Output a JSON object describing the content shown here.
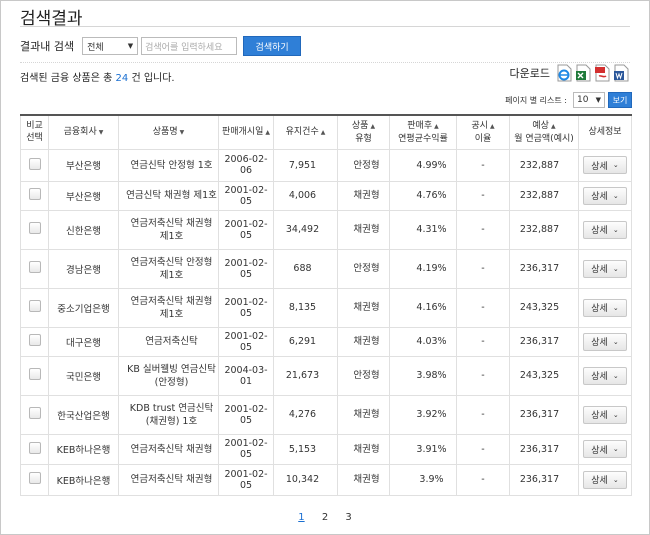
{
  "page_title": "검색결과",
  "search": {
    "label": "결과내 검색",
    "scope_selected": "전체",
    "keyword_placeholder": "검색어를 입력하세요",
    "button": "검색하기"
  },
  "summary": {
    "prefix": "검색된 금융 상품은 총",
    "count": "24",
    "suffix": "건 입니다."
  },
  "download": {
    "label": "다운로드",
    "icons": [
      "internet-explorer-icon",
      "excel-icon",
      "pdf-icon",
      "word-icon"
    ]
  },
  "per_page": {
    "label": "페이지 별 리스트 :",
    "selected": "10",
    "button": "보기"
  },
  "table": {
    "headers": {
      "compare_1": "비교",
      "compare_2": "선택",
      "company": "금융회사",
      "product": "상품명",
      "launch_date": "판매개시일",
      "count": "유지건수",
      "type_1": "상품",
      "type_2": "유형",
      "yield_1": "판매후",
      "yield_2": "연평균수익률",
      "disclosure_1": "공시",
      "disclosure_2": "이율",
      "expected_1": "예상",
      "expected_2": "월 연금액(예시)",
      "detail": "상세정보"
    },
    "rows": [
      {
        "company": "부산은행",
        "product": "연금신탁 안정형 1호",
        "date": "2006-02-06",
        "count": "7,951",
        "type": "안정형",
        "rate": "4.99%",
        "disclosure": "-",
        "expected": "232,887",
        "detail": "상세"
      },
      {
        "company": "부산은행",
        "product": "연금신탁 채권형 제1호",
        "date": "2001-02-05",
        "count": "4,006",
        "type": "채권형",
        "rate": "4.76%",
        "disclosure": "-",
        "expected": "232,887",
        "detail": "상세"
      },
      {
        "company": "신한은행",
        "product": "연금저축신탁 채권형 제1호",
        "date": "2001-02-05",
        "count": "34,492",
        "type": "채권형",
        "rate": "4.31%",
        "disclosure": "-",
        "expected": "232,887",
        "detail": "상세"
      },
      {
        "company": "경남은행",
        "product": "연금저축신탁 안정형 제1호",
        "date": "2001-02-05",
        "count": "688",
        "type": "안정형",
        "rate": "4.19%",
        "disclosure": "-",
        "expected": "236,317",
        "detail": "상세"
      },
      {
        "company": "중소기업은행",
        "product": "연금저축신탁 채권형 제1호",
        "date": "2001-02-05",
        "count": "8,135",
        "type": "채권형",
        "rate": "4.16%",
        "disclosure": "-",
        "expected": "243,325",
        "detail": "상세"
      },
      {
        "company": "대구은행",
        "product": "연금저축신탁",
        "date": "2001-02-05",
        "count": "6,291",
        "type": "채권형",
        "rate": "4.03%",
        "disclosure": "-",
        "expected": "236,317",
        "detail": "상세"
      },
      {
        "company": "국민은행",
        "product": "KB 실버웰빙 연금신탁(안정형)",
        "date": "2004-03-01",
        "count": "21,673",
        "type": "안정형",
        "rate": "3.98%",
        "disclosure": "-",
        "expected": "243,325",
        "detail": "상세"
      },
      {
        "company": "한국산업은행",
        "product": "KDB trust 연금신탁 (채권형) 1호",
        "date": "2001-02-05",
        "count": "4,276",
        "type": "채권형",
        "rate": "3.92%",
        "disclosure": "-",
        "expected": "236,317",
        "detail": "상세"
      },
      {
        "company": "KEB하나은행",
        "product": "연금저축신탁 채권형",
        "date": "2001-02-05",
        "count": "5,153",
        "type": "채권형",
        "rate": "3.91%",
        "disclosure": "-",
        "expected": "236,317",
        "detail": "상세"
      },
      {
        "company": "KEB하나은행",
        "product": "연금저축신탁 채권형",
        "date": "2001-02-05",
        "count": "10,342",
        "type": "채권형",
        "rate": "3.9%",
        "disclosure": "-",
        "expected": "236,317",
        "detail": "상세"
      }
    ]
  },
  "pagination": {
    "pages": [
      "1",
      "2",
      "3"
    ],
    "current": "1"
  }
}
